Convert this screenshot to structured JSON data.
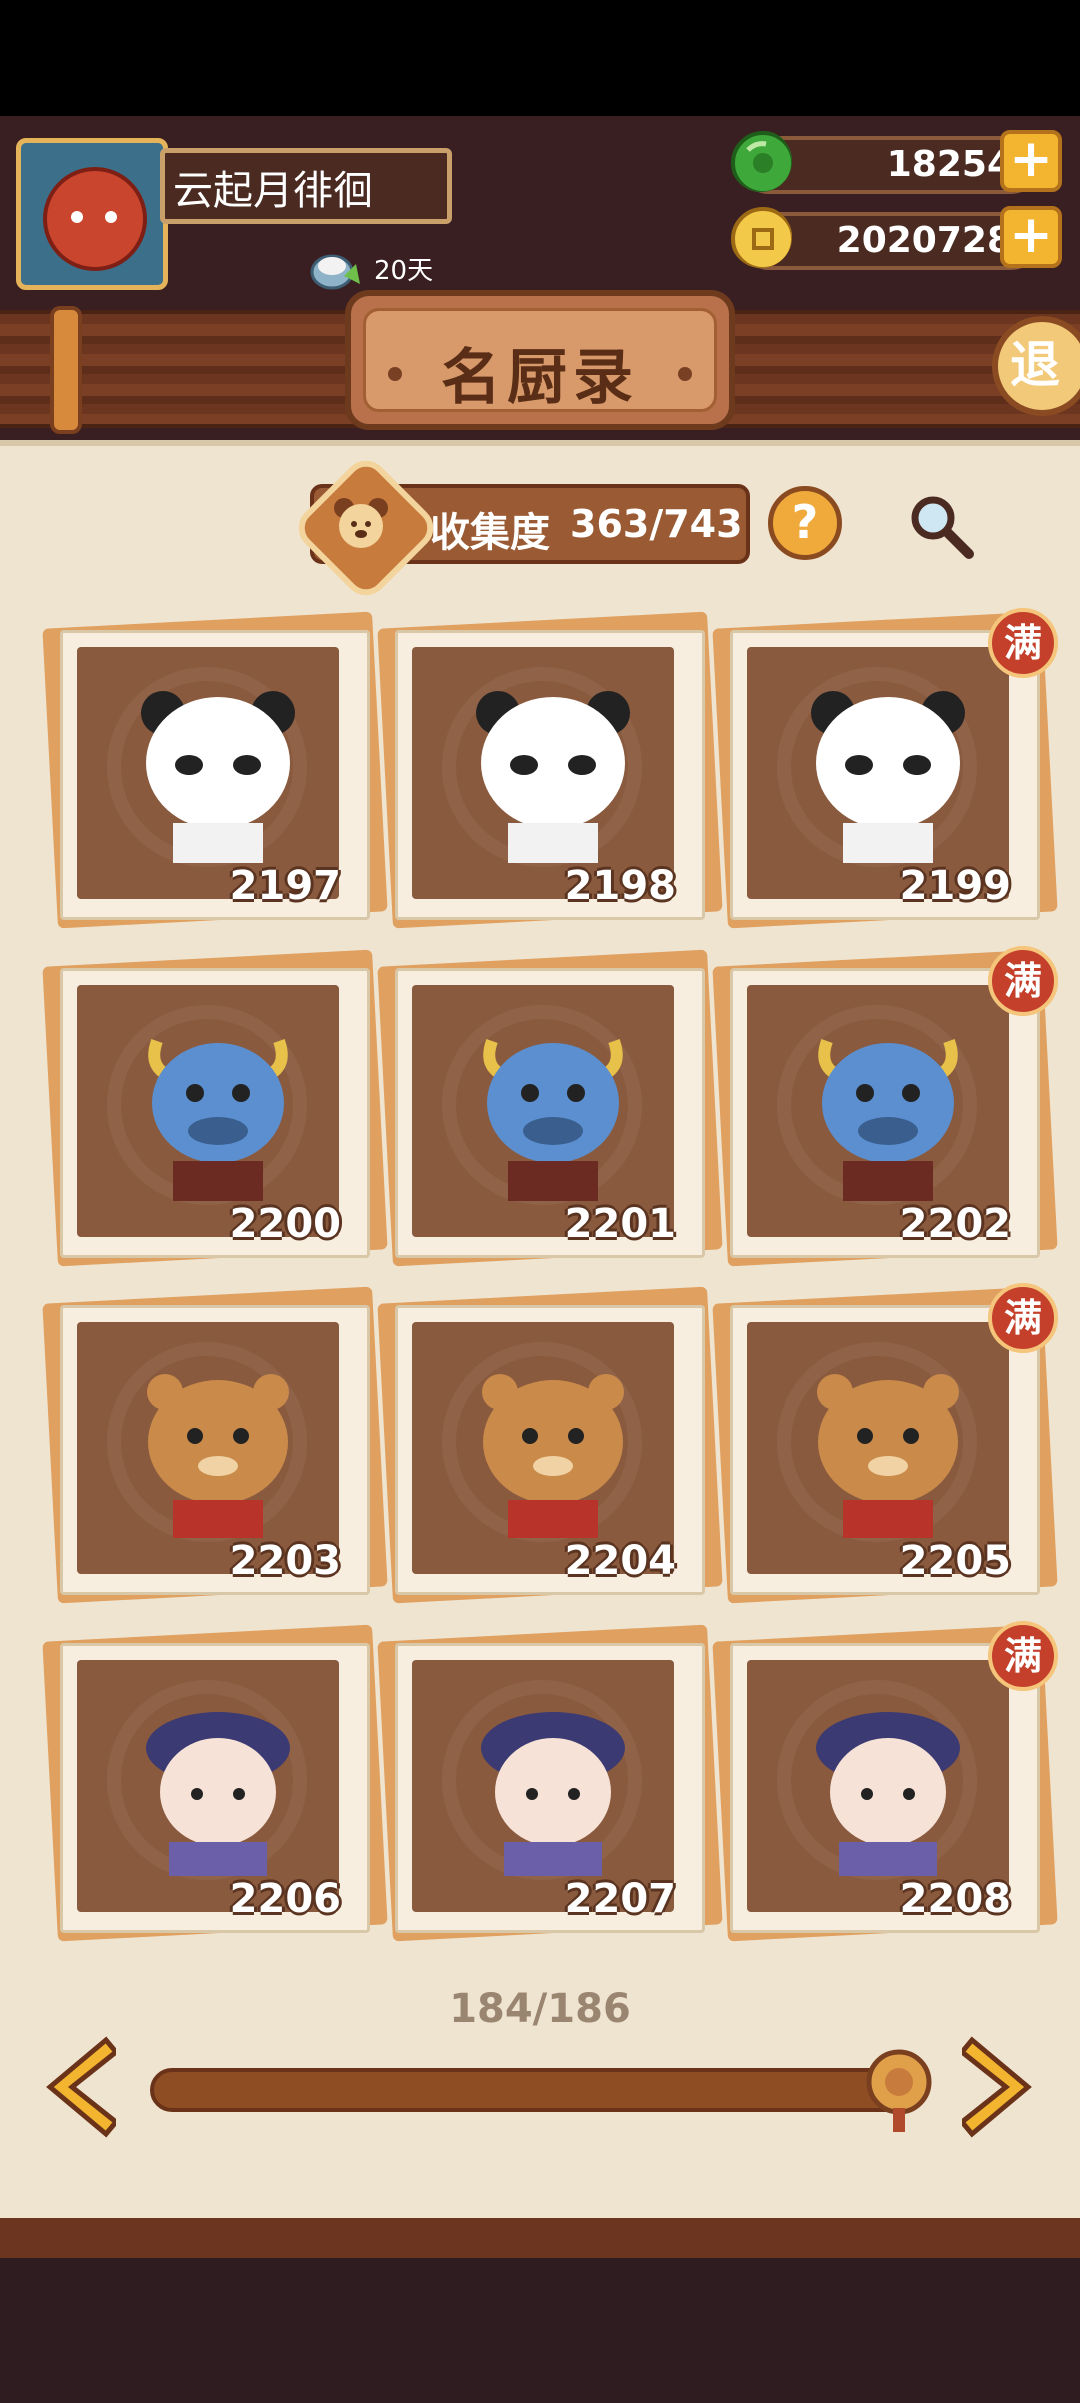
{
  "player": {
    "name": "云起月徘徊",
    "days": "20天"
  },
  "currency": {
    "jade": "18254",
    "coins": "2020728"
  },
  "header": {
    "title": "名厨录",
    "exit_label": "退"
  },
  "collection": {
    "label": "收集度",
    "value": "363/743",
    "help_label": "?"
  },
  "cards": [
    {
      "id": "2197",
      "full": "",
      "kind": "panda",
      "color": "#ffffff"
    },
    {
      "id": "2198",
      "full": "",
      "kind": "panda",
      "color": "#ffffff"
    },
    {
      "id": "2199",
      "full": "满",
      "kind": "panda",
      "color": "#ffffff"
    },
    {
      "id": "2200",
      "full": "",
      "kind": "ox",
      "color": "#5b8fcf"
    },
    {
      "id": "2201",
      "full": "",
      "kind": "ox",
      "color": "#5b8fcf"
    },
    {
      "id": "2202",
      "full": "满",
      "kind": "ox",
      "color": "#5b8fcf"
    },
    {
      "id": "2203",
      "full": "",
      "kind": "tiger",
      "color": "#c98a4a"
    },
    {
      "id": "2204",
      "full": "",
      "kind": "tiger",
      "color": "#c98a4a"
    },
    {
      "id": "2205",
      "full": "满",
      "kind": "tiger",
      "color": "#c98a4a"
    },
    {
      "id": "2206",
      "full": "",
      "kind": "person",
      "color": "#f6e2d6"
    },
    {
      "id": "2207",
      "full": "",
      "kind": "person",
      "color": "#f6e2d6"
    },
    {
      "id": "2208",
      "full": "满",
      "kind": "person",
      "color": "#f6e2d6"
    }
  ],
  "pagination": {
    "page": "184/186",
    "progress": 0.985
  },
  "colors": {
    "panel": "#efe4d0",
    "card_inner": "#8a5a3e",
    "accent": "#f3b52f",
    "full_badge": "#c4402b"
  }
}
